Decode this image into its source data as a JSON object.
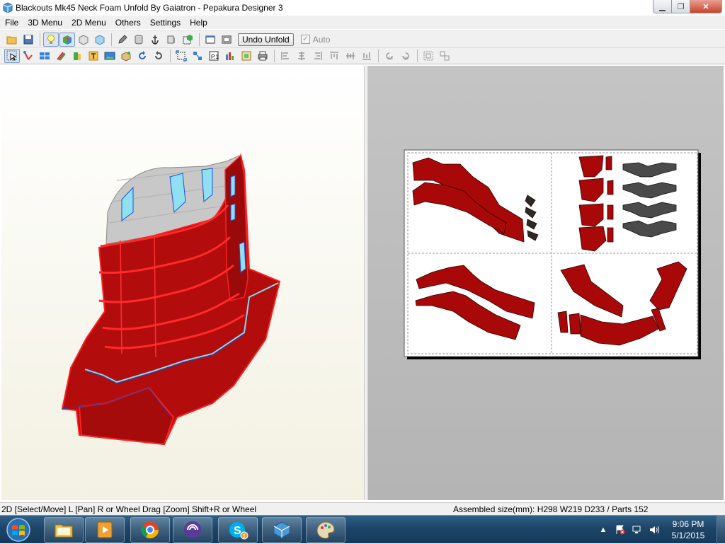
{
  "window": {
    "title": "Blackouts Mk45 Neck Foam Unfold By Gaiatron - Pepakura Designer 3"
  },
  "menu": {
    "items": [
      "File",
      "3D Menu",
      "2D Menu",
      "Others",
      "Settings",
      "Help"
    ]
  },
  "toolbar": {
    "undo_label": "Undo Unfold",
    "auto_label": "Auto",
    "auto_checked": "✓"
  },
  "status": {
    "left": "2D [Select/Move] L [Pan] R or Wheel Drag [Zoom] Shift+R or Wheel",
    "right": "Assembled size(mm): H298 W219 D233 / Parts 152"
  },
  "taskbar": {
    "time": "9:06 PM",
    "date": "5/1/2015",
    "skype_badge": "3",
    "apps": [
      "windows-explorer",
      "media-player",
      "chrome",
      "torrent-client",
      "skype",
      "pepakura",
      "paint"
    ]
  },
  "colors": {
    "part_red": "#b30c0c",
    "edge_red": "#ff2020",
    "edge_cyan": "#7fdcf0",
    "inner_gray": "#c8c8c8",
    "sheet_white": "#ffffff"
  }
}
